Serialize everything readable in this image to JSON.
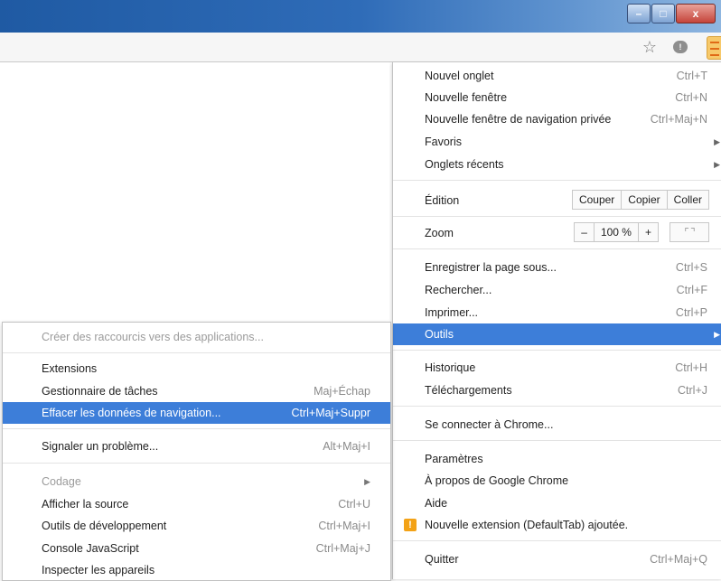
{
  "window": {
    "minimize": "–",
    "maximize": "□",
    "close": "x"
  },
  "toolbar": {
    "star_icon": "star-icon",
    "extension_icon": "extension-icon",
    "menu_icon": "hamburger-menu-icon"
  },
  "menu": {
    "new_tab": {
      "label": "Nouvel onglet",
      "shortcut": "Ctrl+T"
    },
    "new_window": {
      "label": "Nouvelle fenêtre",
      "shortcut": "Ctrl+N"
    },
    "incognito": {
      "label": "Nouvelle fenêtre de navigation privée",
      "shortcut": "Ctrl+Maj+N"
    },
    "bookmarks": {
      "label": "Favoris"
    },
    "recent_tabs": {
      "label": "Onglets récents"
    },
    "edit": {
      "label": "Édition",
      "cut": "Couper",
      "copy": "Copier",
      "paste": "Coller"
    },
    "zoom": {
      "label": "Zoom",
      "minus": "–",
      "value": "100 %",
      "plus": "+",
      "fullscreen": "⌜ ⌝"
    },
    "save_page": {
      "label": "Enregistrer la page sous...",
      "shortcut": "Ctrl+S"
    },
    "find": {
      "label": "Rechercher...",
      "shortcut": "Ctrl+F"
    },
    "print": {
      "label": "Imprimer...",
      "shortcut": "Ctrl+P"
    },
    "tools": {
      "label": "Outils"
    },
    "history": {
      "label": "Historique",
      "shortcut": "Ctrl+H"
    },
    "downloads": {
      "label": "Téléchargements",
      "shortcut": "Ctrl+J"
    },
    "signin": {
      "label": "Se connecter à Chrome..."
    },
    "settings": {
      "label": "Paramètres"
    },
    "about": {
      "label": "À propos de Google Chrome"
    },
    "help": {
      "label": "Aide"
    },
    "new_extension": {
      "label": "Nouvelle extension (DefaultTab) ajoutée.",
      "badge": "!"
    },
    "quit": {
      "label": "Quitter",
      "shortcut": "Ctrl+Maj+Q"
    }
  },
  "submenu": {
    "create_shortcuts": {
      "label": "Créer des raccourcis vers des applications..."
    },
    "extensions": {
      "label": "Extensions"
    },
    "task_manager": {
      "label": "Gestionnaire de tâches",
      "shortcut": "Maj+Échap"
    },
    "clear_data": {
      "label": "Effacer les données de navigation...",
      "shortcut": "Ctrl+Maj+Suppr"
    },
    "report_issue": {
      "label": "Signaler un problème...",
      "shortcut": "Alt+Maj+I"
    },
    "encoding": {
      "label": "Codage"
    },
    "view_source": {
      "label": "Afficher la source",
      "shortcut": "Ctrl+U"
    },
    "dev_tools": {
      "label": "Outils de développement",
      "shortcut": "Ctrl+Maj+I"
    },
    "js_console": {
      "label": "Console JavaScript",
      "shortcut": "Ctrl+Maj+J"
    },
    "inspect_devices": {
      "label": "Inspecter les appareils"
    }
  }
}
